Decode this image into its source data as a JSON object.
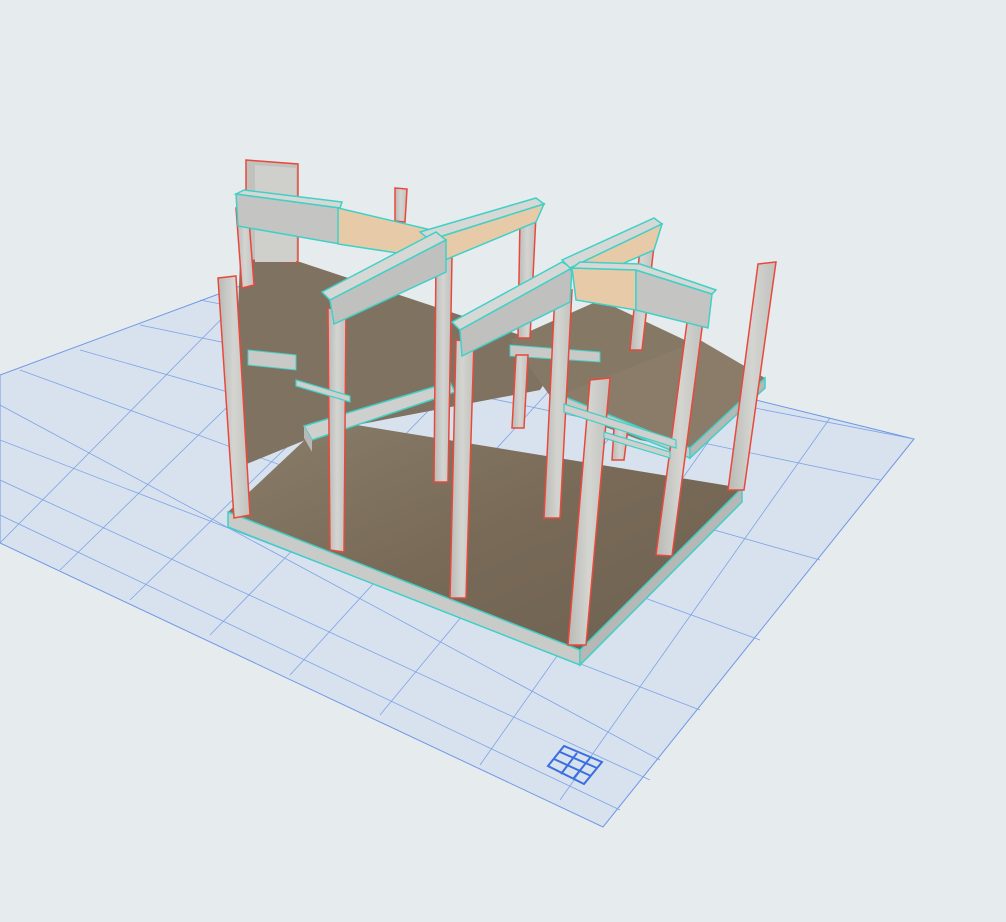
{
  "viewport": {
    "view": "3D",
    "background_color": "#e6ebee",
    "grid_color": "#6f97e6",
    "grid_fill": "#d8e2ef"
  },
  "model": {
    "floor_color": "#7d6f5c",
    "concrete_color": "#c8c8c5",
    "column_outline_color": "#e8493c",
    "beam_outline_color": "#40d0c8",
    "wood_panel_color": "#e7cba8"
  },
  "widgets": {
    "grid_icon": "grid-snap-icon"
  }
}
